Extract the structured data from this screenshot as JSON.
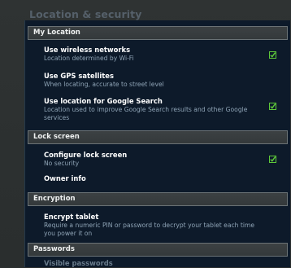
{
  "page_title": "Location & security",
  "sections": {
    "my_location": "My Location",
    "lock_screen": "Lock screen",
    "encryption": "Encryption",
    "passwords": "Passwords"
  },
  "rows": {
    "wireless": {
      "title": "Use wireless networks",
      "summary": "Location determined by Wi-Fi",
      "checked": true
    },
    "gps": {
      "title": "Use GPS satellites",
      "summary": "When locating, accurate to street level",
      "checked": false
    },
    "google_search": {
      "title": "Use location for Google Search",
      "summary": "Location used to improve Google Search results and other Google services",
      "checked": true
    },
    "configure_lock": {
      "title": "Configure lock screen",
      "summary": "No security",
      "checked": true
    },
    "owner_info": {
      "title": "Owner info"
    },
    "encrypt_tablet": {
      "title": "Encrypt tablet",
      "summary": "Require a numeric PIN or password to decrypt your tablet each time you power it on"
    },
    "visible_passwords": {
      "title": "Visible passwords"
    }
  },
  "colors": {
    "background": "#2b2f2f",
    "panel": "#0d1a2a",
    "checkmark": "#5ec83a",
    "summary_text": "#8fa4b6"
  },
  "icons": {
    "checkbox_checked": "checkbox-checked-icon"
  }
}
